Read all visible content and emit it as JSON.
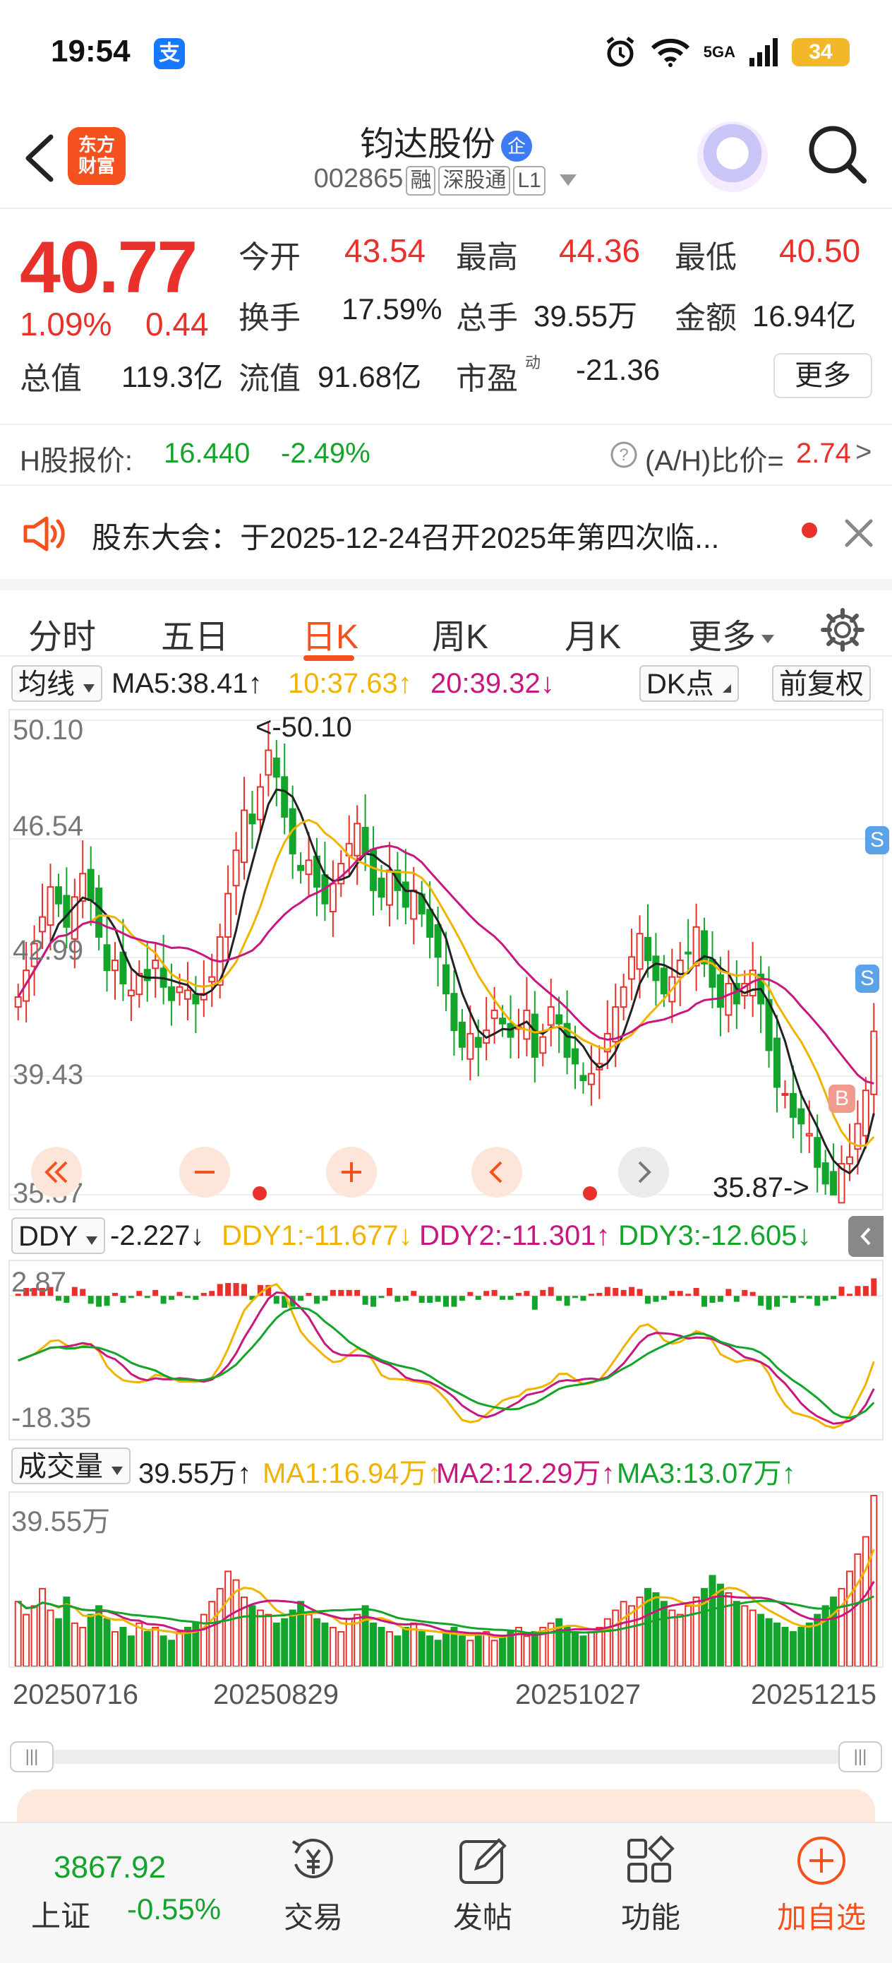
{
  "status_bar": {
    "time": "19:54",
    "pay_badge": "支",
    "network": "5GA",
    "battery": "34"
  },
  "header": {
    "app_logo_top": "东方",
    "app_logo_bottom": "财富",
    "stock_name": "钧达股份",
    "enterprise_badge": "企",
    "stock_code": "002865",
    "tags": [
      "融",
      "深股通",
      "L1"
    ]
  },
  "quote": {
    "price": "40.77",
    "change_pct": "1.09%",
    "change_abs": "0.44",
    "fields": [
      {
        "label": "今开",
        "value": "43.54",
        "color": "#e8312a"
      },
      {
        "label": "最高",
        "value": "44.36",
        "color": "#e8312a"
      },
      {
        "label": "最低",
        "value": "40.50",
        "color": "#e8312a"
      },
      {
        "label": "换手",
        "value": "17.59%",
        "color": "#222222"
      },
      {
        "label": "总手",
        "value": "39.55万",
        "color": "#222222"
      },
      {
        "label": "金额",
        "value": "16.94亿",
        "color": "#222222"
      },
      {
        "label": "总值",
        "value": "119.3亿",
        "color": "#222222"
      },
      {
        "label": "流值",
        "value": "91.68亿",
        "color": "#222222"
      },
      {
        "label": "市盈",
        "value": "-21.36",
        "color": "#222222"
      }
    ],
    "pe_sup": "动",
    "more_label": "更多"
  },
  "h_share": {
    "label": "H股报价:",
    "price": "16.440",
    "change": "-2.49%",
    "ratio_label": "(A/H)比价=",
    "ratio_value": "2.74",
    "arrow": ">"
  },
  "notice": {
    "text": "股东大会：于2025-12-24召开2025年第四次临..."
  },
  "tabs": {
    "items": [
      "分时",
      "五日",
      "日K",
      "周K",
      "月K",
      "更多"
    ],
    "active": "日K"
  },
  "ma_legend": {
    "selector": "均线",
    "ma5": "MA5:38.41↑",
    "ma10": "10:37.63↑",
    "ma20": "20:39.32↓",
    "dk_button": "DK点",
    "adjust_button": "前复权"
  },
  "kline": {
    "y_labels": [
      "50.10",
      "46.54",
      "42.99",
      "39.43",
      "35.87"
    ],
    "high_annotation": "<-50.10",
    "low_annotation": "35.87->",
    "signals": [
      "S",
      "S",
      "B"
    ]
  },
  "ddy": {
    "selector": "DDY",
    "value": "-2.227↓",
    "ddy1": "DDY1:-11.677↓",
    "ddy2": "DDY2:-11.301↑",
    "ddy3": "DDY3:-12.605↓",
    "y_top": "2.87",
    "y_bottom": "-18.35"
  },
  "volume": {
    "selector": "成交量",
    "value": "39.55万↑",
    "ma1": "MA1:16.94万↑",
    "ma2": "MA2:12.29万↑",
    "ma3": "MA3:13.07万↑",
    "y_top": "39.55万"
  },
  "dates": [
    "20250716",
    "20250829",
    "20251027",
    "20251215"
  ],
  "colors": {
    "up": "#e8312a",
    "down": "#13a52b",
    "ma5": "#222222",
    "ma10": "#f0b400",
    "ma20": "#c8177f",
    "accent": "#f4511e"
  },
  "bottom_nav": {
    "index_value": "3867.92",
    "index_name": "上证",
    "index_change": "-0.55%",
    "items": [
      "交易",
      "发帖",
      "功能",
      "加自选"
    ]
  },
  "chart_data": {
    "type": "candlestick",
    "y_range": [
      35.87,
      50.1
    ],
    "x_labels": [
      "20250716",
      "20250829",
      "20251027",
      "20251215"
    ],
    "series": [
      {
        "name": "MA5",
        "last": 38.41
      },
      {
        "name": "MA10",
        "last": 37.63
      },
      {
        "name": "MA20",
        "last": 39.32
      }
    ],
    "closes": [
      41.8,
      42.6,
      43.4,
      44.2,
      45.1,
      44.6,
      43.9,
      44.8,
      45.5,
      44.7,
      43.6,
      42.6,
      42.9,
      42.2,
      42.0,
      42.5,
      42.3,
      42.9,
      42.1,
      41.7,
      42.1,
      42.0,
      41.6,
      41.9,
      42.4,
      43.6,
      44.9,
      46.2,
      47.4,
      47.0,
      48.1,
      49.2,
      48.4,
      47.2,
      46.1,
      45.6,
      45.9,
      45.1,
      44.6,
      45.2,
      45.8,
      46.4,
      47.0,
      46.1,
      45.0,
      44.8,
      45.6,
      45.0,
      44.5,
      45.0,
      44.3,
      43.6,
      43.0,
      41.9,
      40.8,
      40.3,
      40.7,
      40.3,
      40.8,
      41.4,
      41.0,
      40.6,
      40.9,
      41.4,
      40.0,
      40.6,
      41.5,
      41.0,
      40.0,
      39.8,
      39.3,
      39.5,
      39.8,
      40.7,
      41.5,
      42.1,
      43.0,
      43.7,
      42.9,
      42.3,
      41.9,
      42.4,
      42.9,
      43.1,
      43.9,
      42.8,
      42.1,
      41.5,
      42.2,
      41.6,
      42.2,
      42.6,
      41.6,
      40.2,
      39.1,
      38.9,
      38.2,
      38.0,
      37.7,
      36.7,
      36.2,
      35.87,
      36.8,
      37.0,
      38.0,
      39.0,
      40.77
    ],
    "volumes_wan": [
      15,
      12,
      14,
      18,
      13,
      11,
      16,
      10,
      9,
      12,
      14,
      11,
      8,
      9,
      7,
      10,
      8,
      9,
      7,
      6,
      8,
      9,
      10,
      12,
      15,
      18,
      22,
      20,
      16,
      14,
      13,
      12,
      10,
      11,
      13,
      15,
      12,
      11,
      10,
      9,
      8,
      11,
      12,
      14,
      10,
      9,
      8,
      7,
      9,
      10,
      8,
      7,
      6,
      8,
      9,
      7,
      6,
      7,
      8,
      6,
      7,
      8,
      9,
      7,
      8,
      9,
      10,
      11,
      9,
      8,
      7,
      8,
      9,
      11,
      13,
      15,
      14,
      16,
      18,
      17,
      15,
      13,
      12,
      14,
      16,
      18,
      21,
      19,
      17,
      15,
      14,
      13,
      12,
      11,
      10,
      9,
      8,
      9,
      10,
      12,
      14,
      16,
      18,
      22,
      26,
      30,
      39.55
    ]
  }
}
